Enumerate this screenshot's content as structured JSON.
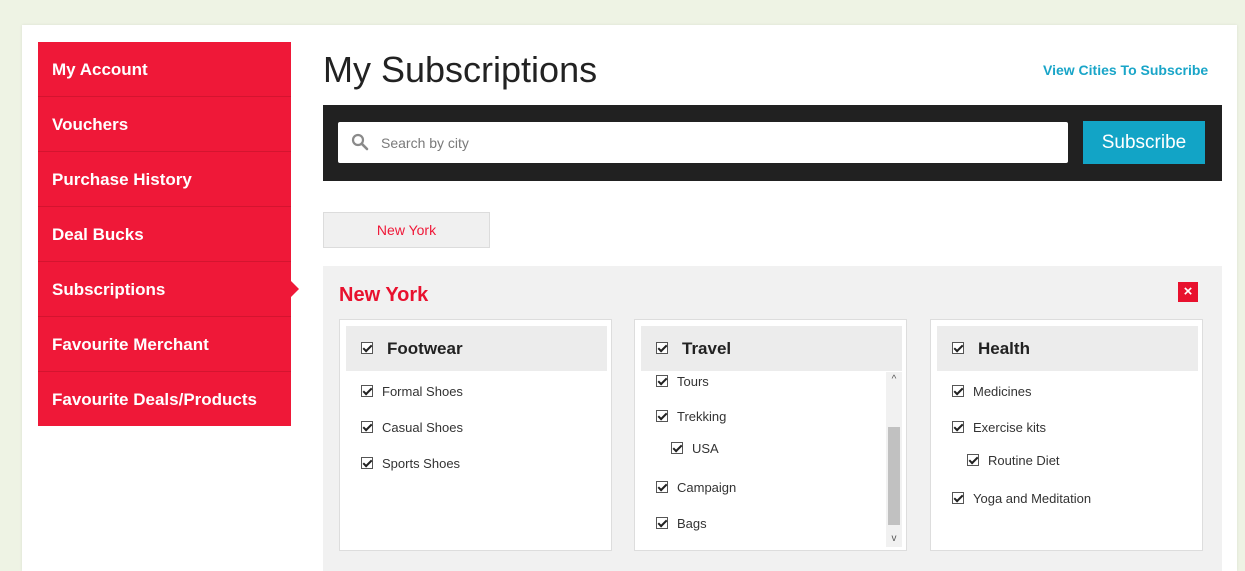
{
  "sidebar": {
    "items": [
      {
        "label": "My Account"
      },
      {
        "label": "Vouchers"
      },
      {
        "label": "Purchase History"
      },
      {
        "label": "Deal Bucks"
      },
      {
        "label": "Subscriptions"
      },
      {
        "label": "Favourite Merchant"
      },
      {
        "label": "Favourite Deals/Products"
      }
    ],
    "active": "Subscriptions"
  },
  "header": {
    "title": "My Subscriptions",
    "view_cities_link": "View Cities To Subscribe"
  },
  "search": {
    "placeholder": "Search by city",
    "value": "",
    "subscribe_label": "Subscribe"
  },
  "city_tabs": [
    "New York"
  ],
  "city_section": {
    "title": "New York",
    "close_label": "×",
    "cards": {
      "footwear": {
        "title": "Footwear",
        "items": [
          "Formal Shoes",
          "Casual Shoes",
          "Sports Shoes"
        ]
      },
      "travel": {
        "title": "Travel",
        "items": [
          "Tours",
          "Trekking",
          "USA",
          "Campaign",
          "Bags"
        ]
      },
      "health": {
        "title": "Health",
        "items": [
          "Medicines",
          "Exercise kits",
          "Routine Diet",
          "Yoga and Meditation"
        ]
      }
    }
  },
  "colors": {
    "brand_red": "#ef1838",
    "accent_blue": "#12a4c6",
    "dark_bar": "#212121"
  },
  "icons": [
    "search-icon",
    "close-icon",
    "checkbox-icon",
    "chevron-up-icon",
    "chevron-down-icon"
  ]
}
